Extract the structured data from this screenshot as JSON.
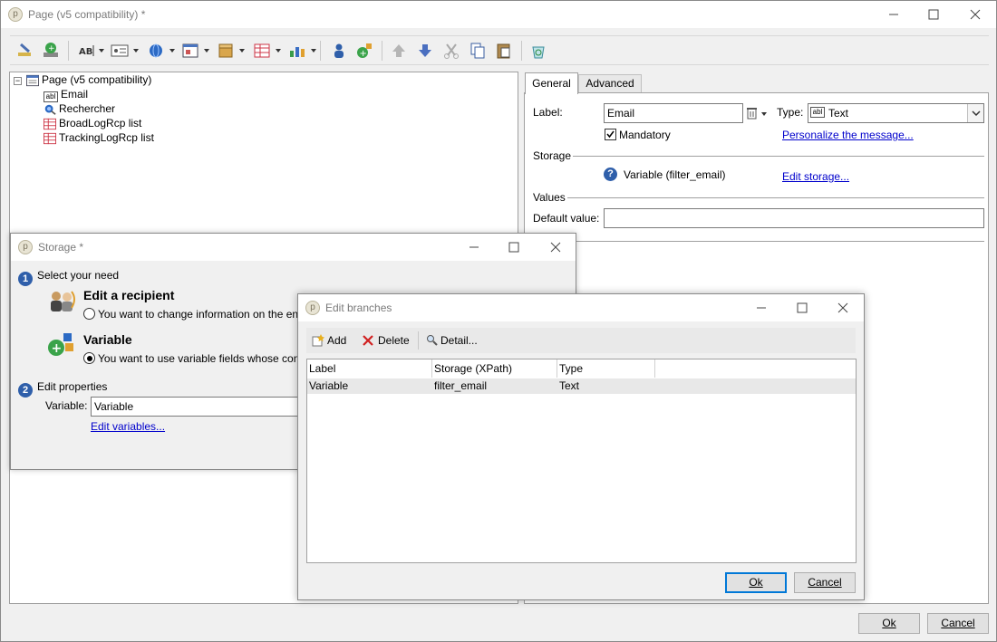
{
  "main": {
    "title": "Page (v5 compatibility) *",
    "ok": "Ok",
    "cancel": "Cancel"
  },
  "tree": {
    "root": "Page (v5 compatibility)",
    "children": [
      "Email",
      "Rechercher",
      "BroadLogRcp list",
      "TrackingLogRcp list"
    ]
  },
  "tabs": {
    "general": "General",
    "advanced": "Advanced"
  },
  "form": {
    "label_caption": "Label:",
    "label_value": "Email",
    "type_caption": "Type:",
    "type_value": "Text",
    "mandatory": "Mandatory",
    "personalize": "Personalize the message...",
    "storage_section": "Storage",
    "storage_value": "Variable (filter_email)",
    "edit_storage": "Edit storage...",
    "values_section": "Values",
    "default_caption": "Default value:",
    "default_value": ""
  },
  "storage_dialog": {
    "title": "Storage *",
    "step1": "Select your need",
    "step1_num": "1",
    "opt1_title": "Edit a recipient",
    "opt1_desc": "You want to change information on the en",
    "opt2_title": "Variable",
    "opt2_desc": "You want to use variable fields whose con",
    "step2": "Edit properties",
    "step2_num": "2",
    "variable_caption": "Variable:",
    "variable_value": "Variable",
    "edit_variables": "Edit variables..."
  },
  "branches_dialog": {
    "title": "Edit branches",
    "add": "Add",
    "delete": "Delete",
    "detail": "Detail...",
    "columns": [
      "Label",
      "Storage (XPath)",
      "Type"
    ],
    "rows": [
      [
        "Variable",
        "filter_email",
        "Text"
      ]
    ],
    "ok": "Ok",
    "cancel": "Cancel"
  }
}
